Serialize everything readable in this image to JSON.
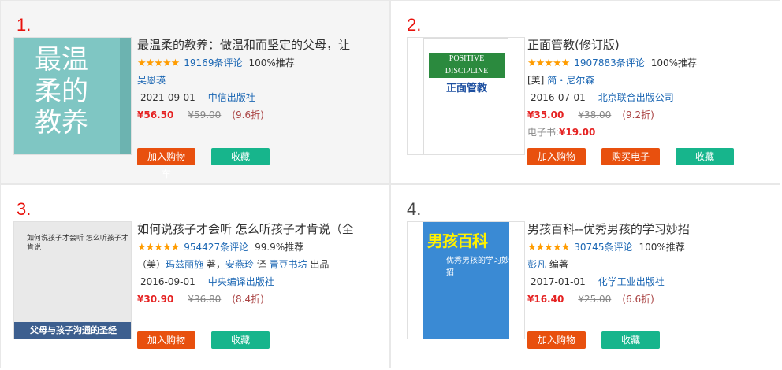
{
  "books": [
    {
      "rank": "1.",
      "title": "最温柔的教养：做温和而坚定的父母，让",
      "stars": "★★★★★",
      "reviews": "19169条评论",
      "recommend": "100%推荐",
      "author_line": "吴恩瑛",
      "date": "2021-09-01",
      "publisher": "中信出版社",
      "price": "¥56.50",
      "orig_price": "¥59.00",
      "discount": "(9.6折)",
      "cover_title": "最温柔的教养",
      "btn_cart": "加入购物车",
      "btn_fav": "收藏"
    },
    {
      "rank": "2.",
      "title": "正面管教(修订版)",
      "stars": "★★★★★",
      "reviews": "1907883条评论",
      "recommend": "100%推荐",
      "author_prefix": "[美]",
      "author_line": "简・尼尔森",
      "date": "2016-07-01",
      "publisher": "北京联合出版公司",
      "price": "¥35.00",
      "orig_price": "¥38.00",
      "discount": "(9.2折)",
      "ebook_label": "电子书:",
      "ebook_price": "¥19.00",
      "cover_title_en": "POSITIVE DISCIPLINE",
      "cover_title": "正面管教",
      "btn_cart": "加入购物车",
      "btn_ebook": "购买电子书",
      "btn_fav": "收藏"
    },
    {
      "rank": "3.",
      "title": "如何说孩子才会听 怎么听孩子才肯说（全",
      "stars": "★★★★★",
      "reviews": "954427条评论",
      "recommend": "99.9%推荐",
      "author_a_prefix": "（美）",
      "author_a": "玛兹丽施",
      "author_a_role": "著，",
      "author_b": "安燕玲",
      "author_b_role": "译",
      "author_c": "青豆书坊",
      "author_c_role": "出品",
      "date": "2016-09-01",
      "publisher": "中央编译出版社",
      "price": "¥30.90",
      "orig_price": "¥36.80",
      "discount": "(8.4折)",
      "cover_title": "如何说孩子才会听 怎么听孩子才肯说",
      "cover_band": "父母与孩子沟通的圣经",
      "btn_cart": "加入购物车",
      "btn_fav": "收藏"
    },
    {
      "rank": "4.",
      "title": "男孩百科--优秀男孩的学习妙招",
      "stars": "★★★★★",
      "reviews": "30745条评论",
      "recommend": "100%推荐",
      "author_line": "彭凡",
      "author_role": "编著",
      "date": "2017-01-01",
      "publisher": "化学工业出版社",
      "price": "¥16.40",
      "orig_price": "¥25.00",
      "discount": "(6.6折)",
      "cover_title": "男孩百科",
      "cover_sub": "优秀男孩的学习妙招",
      "btn_cart": "加入购物车",
      "btn_fav": "收藏"
    }
  ]
}
